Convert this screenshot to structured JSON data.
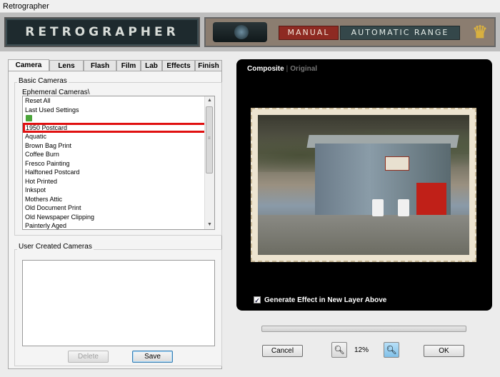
{
  "window": {
    "title": "Retrographer"
  },
  "banner": {
    "logo_text": "RETROGRAPHER",
    "manual_label": "MANUAL",
    "automatic_label": "AUTOMATIC RANGE",
    "icon": "crown-icon"
  },
  "tabs": [
    {
      "label": "Camera",
      "active": true
    },
    {
      "label": "Lens"
    },
    {
      "label": "Flash"
    },
    {
      "label": "Film"
    },
    {
      "label": "Lab"
    },
    {
      "label": "Effects"
    },
    {
      "label": "Finish"
    }
  ],
  "basic_cameras": {
    "group_label": "Basic Cameras",
    "sub_label": "Ephemeral Cameras\\",
    "items": [
      "Reset All",
      "Last Used Settings",
      "",
      "1950 Postcard",
      "Aquatic",
      "Brown Bag Print",
      "Coffee Burn",
      "Fresco Painting",
      "Halftoned Postcard",
      "Hot Printed",
      "Inkspot",
      "Mothers Attic",
      "Old Document Print",
      "Old Newspaper Clipping",
      "Painterly Aged"
    ],
    "selected": "1950 Postcard"
  },
  "user_cameras": {
    "group_label": "User Created Cameras",
    "delete_label": "Delete",
    "save_label": "Save"
  },
  "preview": {
    "composite_label": "Composite",
    "original_label": "Original",
    "generate_label": "Generate Effect in New Layer Above",
    "generate_checked": true
  },
  "bottom": {
    "cancel_label": "Cancel",
    "zoom_level": "12%",
    "ok_label": "OK"
  },
  "colors": {
    "selection_outline": "#e01010",
    "manual_button": "#8e2a22",
    "auto_button": "#34474a"
  }
}
